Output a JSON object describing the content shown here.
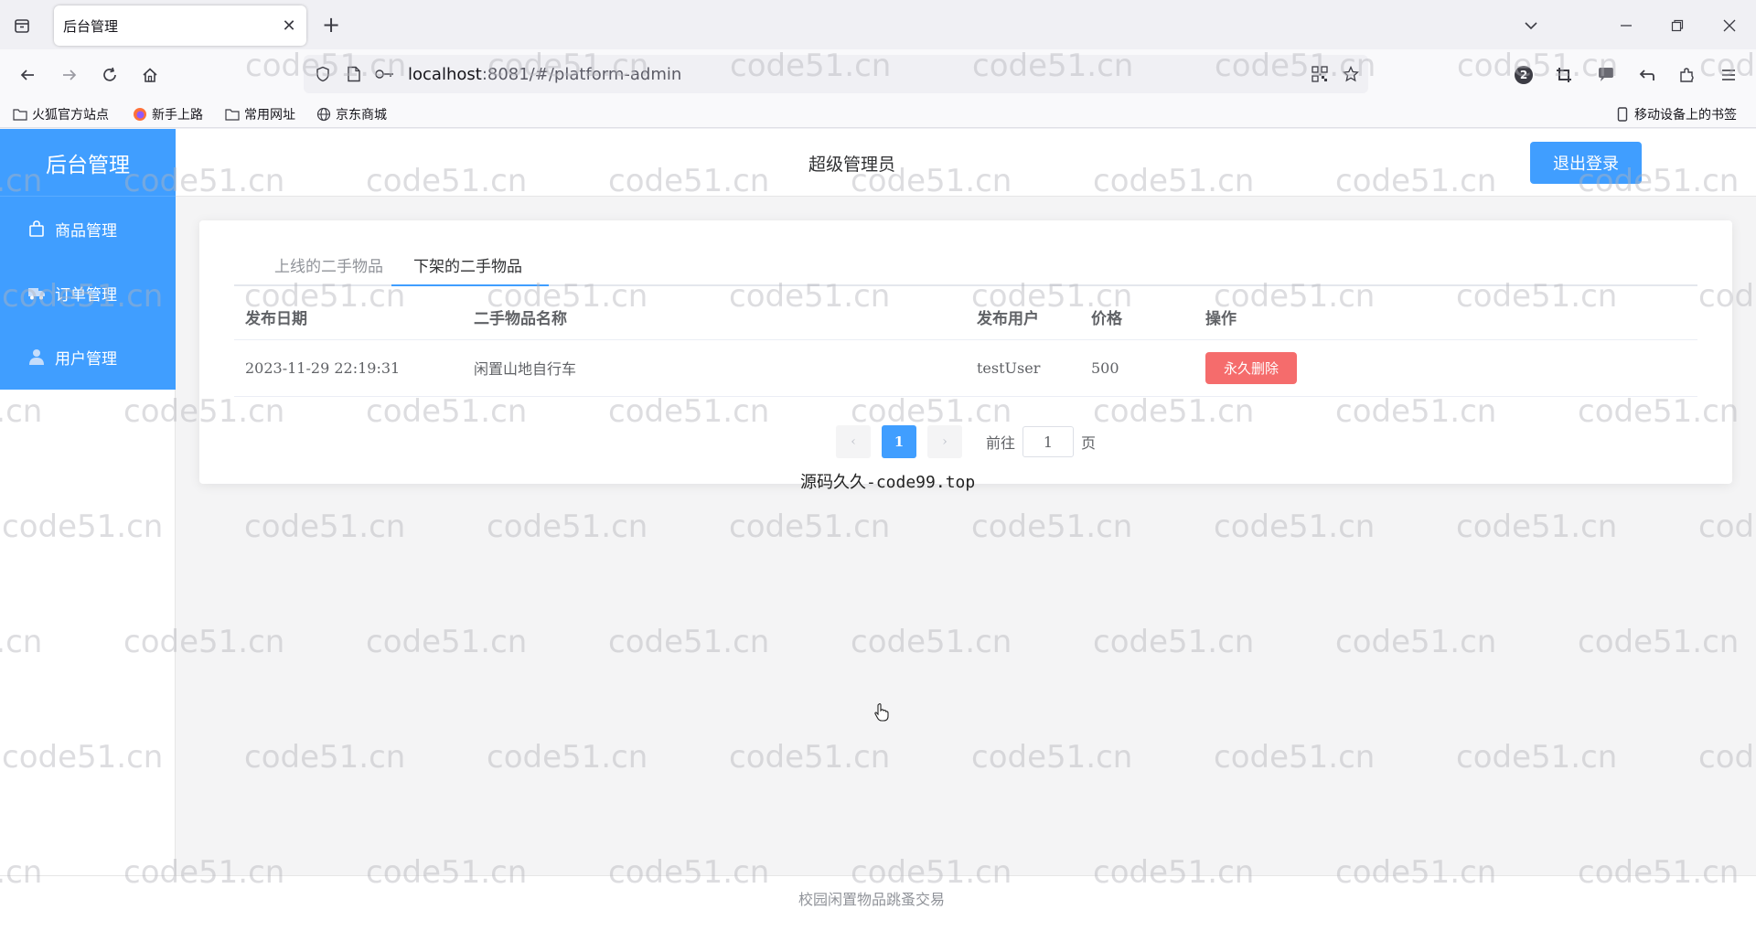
{
  "browser": {
    "tab_title": "后台管理",
    "url_host": "localhost",
    "url_rest": ":8081/#/platform-admin",
    "notification_count": "2",
    "bookmarks": [
      "火狐官方站点",
      "新手上路",
      "常用网址",
      "京东商城"
    ],
    "mobile_bookmarks": "移动设备上的书签"
  },
  "sidebar": {
    "brand": "后台管理",
    "items": [
      {
        "label": "商品管理",
        "icon": "shopping-bag-icon"
      },
      {
        "label": "订单管理",
        "icon": "truck-icon"
      },
      {
        "label": "用户管理",
        "icon": "user-icon"
      }
    ]
  },
  "header": {
    "role": "超级管理员",
    "logout_label": "退出登录"
  },
  "tabs": {
    "online": "上线的二手物品",
    "offline": "下架的二手物品"
  },
  "table": {
    "columns": [
      "发布日期",
      "二手物品名称",
      "发布用户",
      "价格",
      "操作"
    ],
    "rows": [
      {
        "date": "2023-11-29 22:19:31",
        "name": "闲置山地自行车",
        "user": "testUser",
        "price": "500",
        "action": "永久删除"
      }
    ]
  },
  "pagination": {
    "current": "1",
    "goto_prefix": "前往",
    "goto_value": "1",
    "goto_suffix": "页"
  },
  "source_note": "源码久久-code99.top",
  "footer": "校园闲置物品跳蚤交易",
  "watermark": "code51.cn",
  "colors": {
    "primary": "#409eff",
    "danger": "#f56c6c"
  }
}
